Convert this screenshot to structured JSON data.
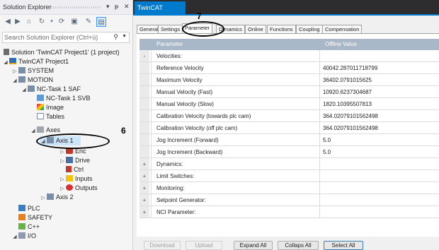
{
  "solution_explorer": {
    "title": "Solution Explorer",
    "window_buttons": [
      "▾",
      "ᵽ",
      "✕"
    ],
    "search_placeholder": "Search Solution Explorer (Ctrl+ü)",
    "tree": [
      {
        "label": "Solution 'TwinCAT Project1' (1 project)",
        "icon": "solution-icon"
      },
      {
        "label": "TwinCAT Project1",
        "icon": "project-icon"
      },
      {
        "label": "SYSTEM",
        "icon": "system-icon"
      },
      {
        "label": "MOTION",
        "icon": "motion-icon"
      },
      {
        "label": "NC-Task 1 SAF",
        "icon": "task-icon"
      },
      {
        "label": "NC-Task 1 SVB",
        "icon": "task-svb-icon"
      },
      {
        "label": "Image",
        "icon": "image-icon"
      },
      {
        "label": "Tables",
        "icon": "tables-icon"
      },
      {
        "label": "Axes",
        "icon": "axes-icon"
      },
      {
        "label": "Axis 1",
        "icon": "axis-icon"
      },
      {
        "label": "Enc",
        "icon": "encoder-icon"
      },
      {
        "label": "Drive",
        "icon": "drive-icon"
      },
      {
        "label": "Ctrl",
        "icon": "controller-icon"
      },
      {
        "label": "Inputs",
        "icon": "inputs-icon"
      },
      {
        "label": "Outputs",
        "icon": "outputs-icon"
      },
      {
        "label": "Axis 2",
        "icon": "axis-icon"
      },
      {
        "label": "PLC",
        "icon": "plc-icon"
      },
      {
        "label": "SAFETY",
        "icon": "safety-icon"
      },
      {
        "label": "C++",
        "icon": "cpp-icon"
      },
      {
        "label": "I/O",
        "icon": "io-icon"
      }
    ],
    "callout": "6"
  },
  "document": {
    "tab_title": "TwinCAT Project1",
    "tab_pin": "⊕",
    "tab_close": "✕",
    "callout": "7",
    "property_tabs": [
      "General",
      "Settings",
      "Parameter",
      "Dynamics",
      "Online",
      "Functions",
      "Coupling",
      "Compensation"
    ],
    "active_tab": "Parameter",
    "grid": {
      "col_parameter": "Parameter",
      "col_value": "Offline Value",
      "rows": [
        {
          "gutter": "-",
          "name": "Velocities:",
          "value": ""
        },
        {
          "gutter": "",
          "name": "Reference Velocity",
          "value": "40042.287011718799"
        },
        {
          "gutter": "",
          "name": "Maximum Velocity",
          "value": "36402.0791015625"
        },
        {
          "gutter": "",
          "name": "Manual Velocity (Fast)",
          "value": "10920.6237304687"
        },
        {
          "gutter": "",
          "name": "Manual Velocity (Slow)",
          "value": "1820.10395507813"
        },
        {
          "gutter": "",
          "name": "Calibration Velocity (towards plc cam)",
          "value": "364.02079101562498"
        },
        {
          "gutter": "",
          "name": "Calibration Velocity (off plc cam)",
          "value": "364.02079101562498"
        },
        {
          "gutter": "",
          "name": "Jog Increment (Forward)",
          "value": "5.0"
        },
        {
          "gutter": "",
          "name": "Jog Increment (Backward)",
          "value": "5.0"
        },
        {
          "gutter": "+",
          "name": "Dynamics:",
          "value": ""
        },
        {
          "gutter": "+",
          "name": "Limit Switches:",
          "value": ""
        },
        {
          "gutter": "+",
          "name": "Monitoring:",
          "value": ""
        },
        {
          "gutter": "+",
          "name": "Setpoint Generator:",
          "value": ""
        },
        {
          "gutter": "+",
          "name": "NCI Parameter:",
          "value": ""
        }
      ]
    },
    "buttons": {
      "download": "Download",
      "upload": "Upload",
      "expand_all": "Expand All",
      "collapse_all": "Collaps All",
      "select_all": "Select All"
    }
  }
}
